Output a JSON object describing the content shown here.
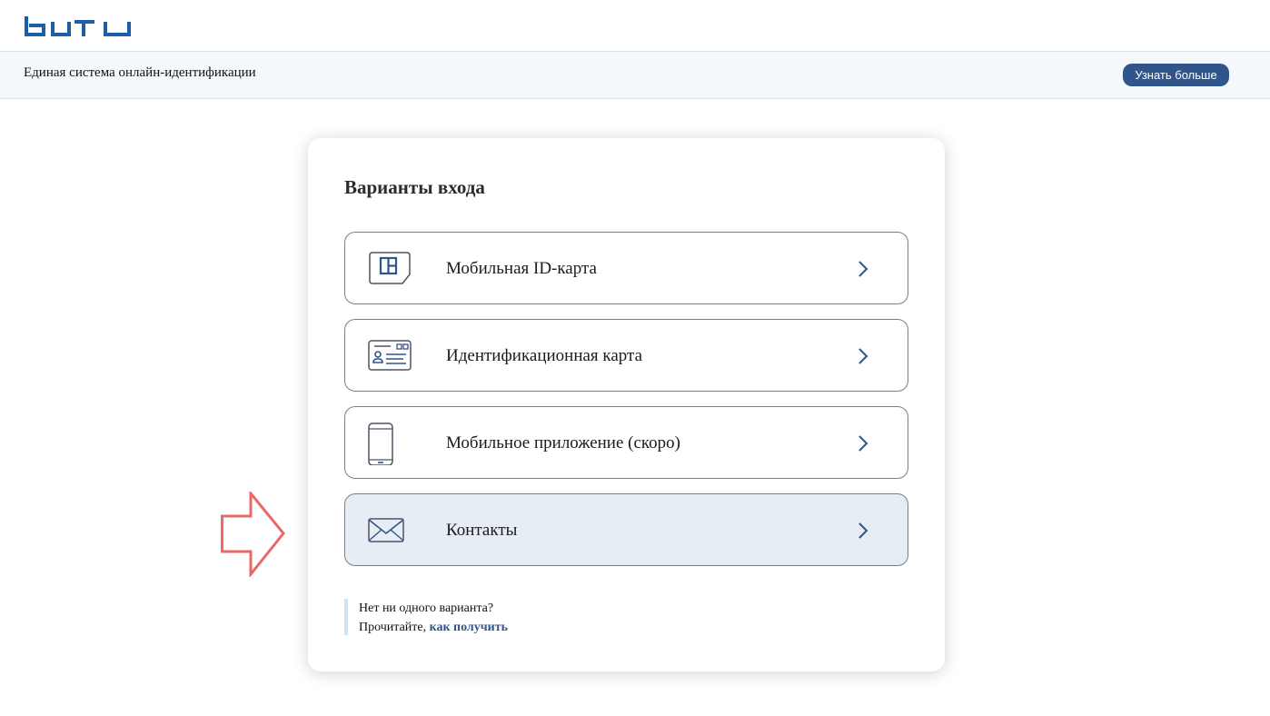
{
  "header": {
    "logo_text": "tutu",
    "info_text": "Единая система онлайн-идентификации",
    "learn_more_label": "Узнать больше"
  },
  "card": {
    "title": "Варианты входа",
    "options": [
      {
        "label": "Мобильная ID-карта",
        "icon": "sim-card-icon"
      },
      {
        "label": "Идентификационная карта",
        "icon": "id-card-icon"
      },
      {
        "label": "Мобильное приложение (скоро)",
        "icon": "smartphone-icon"
      },
      {
        "label": "Контакты",
        "icon": "envelope-icon",
        "highlighted": true
      }
    ],
    "note": {
      "line1": "Нет ни одного варианта?",
      "line2_prefix": "Прочитайте,",
      "link": "как получить"
    }
  },
  "colors": {
    "brand": "#2f558a",
    "arrow": "#e8696a",
    "highlight_bg": "#e6edf4"
  }
}
